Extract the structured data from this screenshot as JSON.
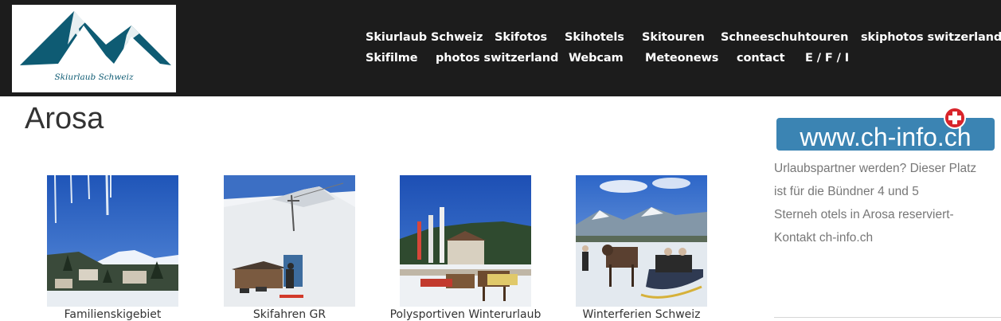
{
  "header": {
    "logo": {
      "text": "Skiurlaub Schweiz",
      "icon": "mountain-logo",
      "color": "#0e5b73"
    },
    "nav": [
      {
        "label": "Skiurlaub Schweiz"
      },
      {
        "label": "Skifotos"
      },
      {
        "label": "Skihotels"
      },
      {
        "label": "Skitouren"
      },
      {
        "label": "Schneeschuhtouren"
      },
      {
        "label": "skiphotos switzerland"
      },
      {
        "label": "Skifilme"
      },
      {
        "label": "photos switzerland"
      },
      {
        "label": "Webcam"
      },
      {
        "label": "Meteonews"
      },
      {
        "label": "contact"
      },
      {
        "label": "E / F / I"
      }
    ]
  },
  "main": {
    "title": "Arosa",
    "gallery": [
      {
        "caption": "Familienskigebiet",
        "image": "arosa-village-icicles"
      },
      {
        "caption": "Skifahren GR",
        "image": "ski-slope-hut"
      },
      {
        "caption": "Polysportiven Winterurlaub",
        "image": "arosa-church-horses"
      },
      {
        "caption": "Winterferien Schweiz",
        "image": "horse-sleigh-ride"
      }
    ]
  },
  "sidebar": {
    "banner": {
      "text": "www.ch-info.ch",
      "icon": "swiss-cross-icon",
      "color": "#3b84b3"
    },
    "lines": [
      "Urlaubspartner werden? Dieser Platz",
      "ist für die Bündner 4 und 5",
      "Sterneh otels in Arosa reserviert-",
      "Kontakt ch-info.ch"
    ]
  }
}
